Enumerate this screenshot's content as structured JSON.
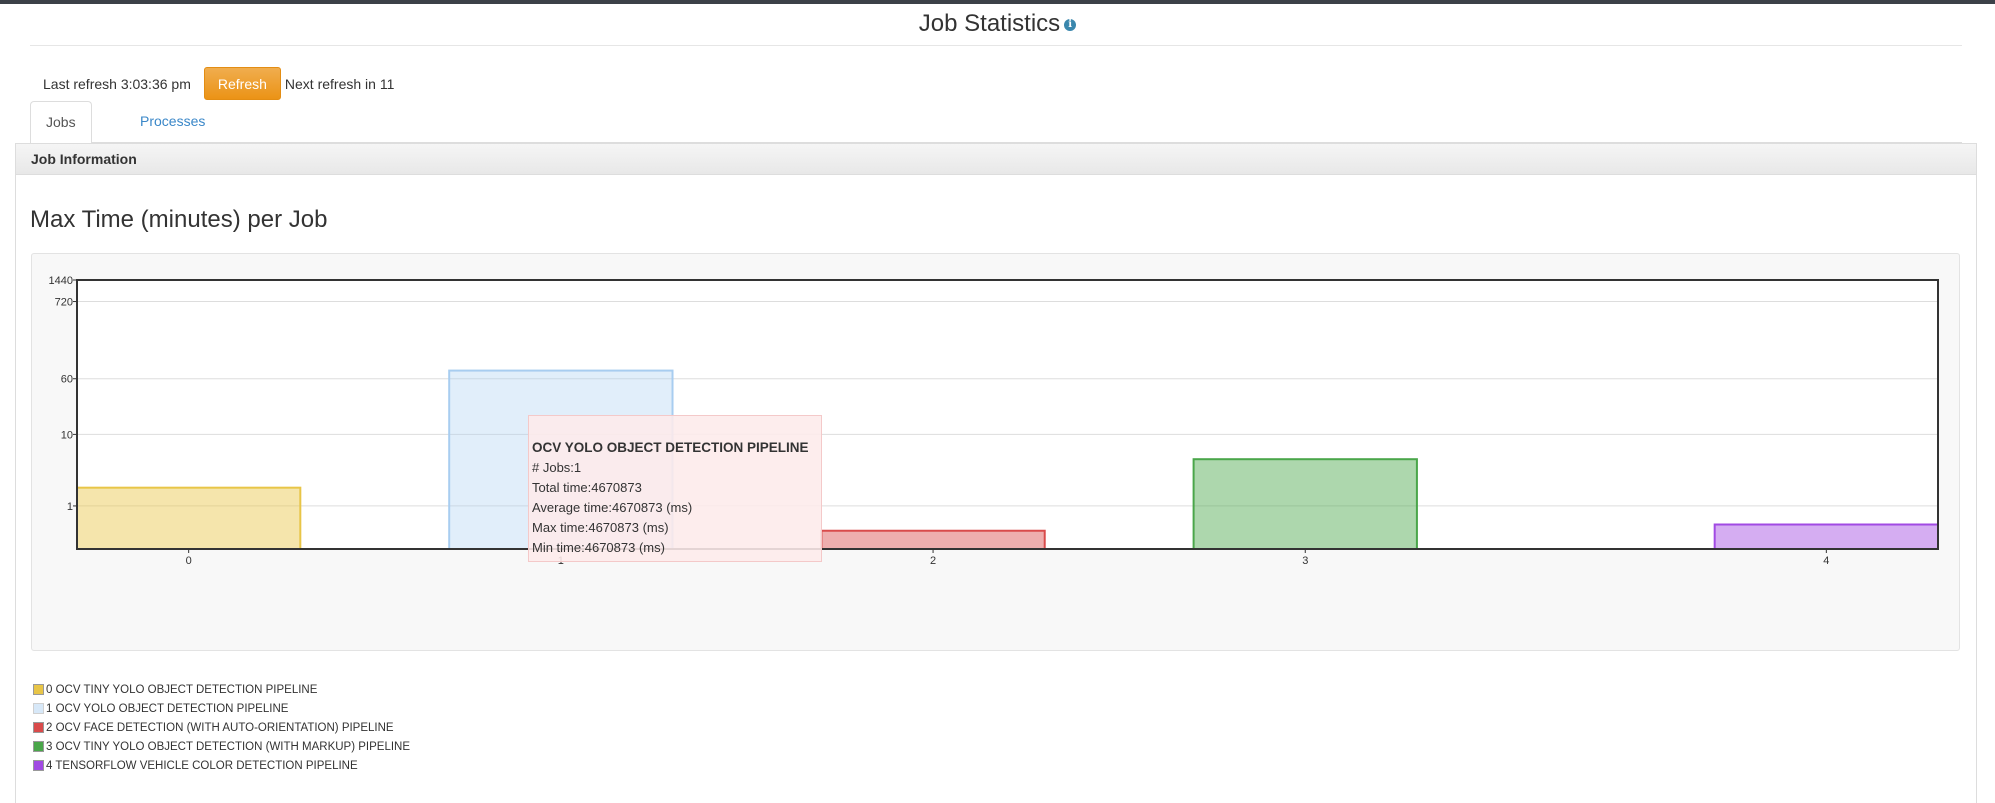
{
  "page": {
    "title": "Job Statistics",
    "info_icon": "info-icon"
  },
  "refresh": {
    "last_refresh": "Last refresh 3:03:36 pm",
    "button_label": "Refresh",
    "next_refresh": "Next refresh in 11"
  },
  "tabs": [
    {
      "label": "Jobs",
      "active": true
    },
    {
      "label": "Processes",
      "active": false
    }
  ],
  "panel": {
    "heading": "Job Information"
  },
  "chart_data": {
    "type": "bar",
    "title": "Max Time (minutes) per Job",
    "y_scale": "log",
    "y_ticks": [
      "1440",
      "720",
      "60",
      "10",
      "1"
    ],
    "ylim": [
      0.25,
      1440
    ],
    "categories": [
      "0",
      "1",
      "2",
      "3",
      "4"
    ],
    "values": [
      1.8,
      78,
      0.45,
      4.5,
      0.55
    ],
    "colors": [
      "#e8c547",
      "#a8cdf0",
      "#d94b4b",
      "#4aa64a",
      "#a14ae3"
    ],
    "grid": true,
    "legend_position": "bottom-left",
    "legend": [
      "0 OCV TINY YOLO OBJECT DETECTION PIPELINE",
      "1 OCV YOLO OBJECT DETECTION PIPELINE",
      "2 OCV FACE DETECTION (WITH AUTO-ORIENTATION) PIPELINE",
      "3 OCV TINY YOLO OBJECT DETECTION (WITH MARKUP) PIPELINE",
      "4 TENSORFLOW VEHICLE COLOR DETECTION PIPELINE"
    ]
  },
  "tooltip": {
    "title": "OCV YOLO OBJECT DETECTION PIPELINE",
    "jobs": "# Jobs:1",
    "total": "Total time:4670873",
    "average": "Average time:4670873 (ms)",
    "max": "Max time:4670873 (ms)",
    "min": "Min time:4670873 (ms)"
  }
}
